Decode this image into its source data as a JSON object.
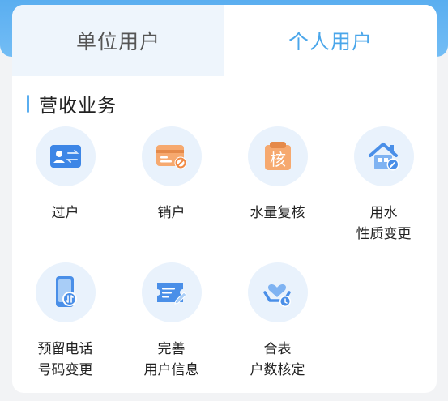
{
  "tabs": [
    {
      "label": "单位用户",
      "active": false
    },
    {
      "label": "个人用户",
      "active": true
    }
  ],
  "section": {
    "title": "营收业务"
  },
  "items": [
    {
      "icon": "id-card-transfer-icon",
      "lines": [
        "过户"
      ]
    },
    {
      "icon": "card-cancel-icon",
      "lines": [
        "销户"
      ]
    },
    {
      "icon": "verify-document-icon",
      "lines": [
        "水量复核"
      ],
      "glyph": "核"
    },
    {
      "icon": "house-edit-icon",
      "lines": [
        "用水",
        "性质变更"
      ]
    },
    {
      "icon": "phone-switch-icon",
      "lines": [
        "预留电话",
        "号码变更"
      ]
    },
    {
      "icon": "ticket-edit-icon",
      "lines": [
        "完善",
        "用户信息"
      ]
    },
    {
      "icon": "hand-heart-meter-icon",
      "lines": [
        "合表",
        "户数核定"
      ]
    }
  ],
  "colors": {
    "accent": "#4aa6ea",
    "orange": "#f5a066",
    "blue": "#4a8fe8"
  }
}
